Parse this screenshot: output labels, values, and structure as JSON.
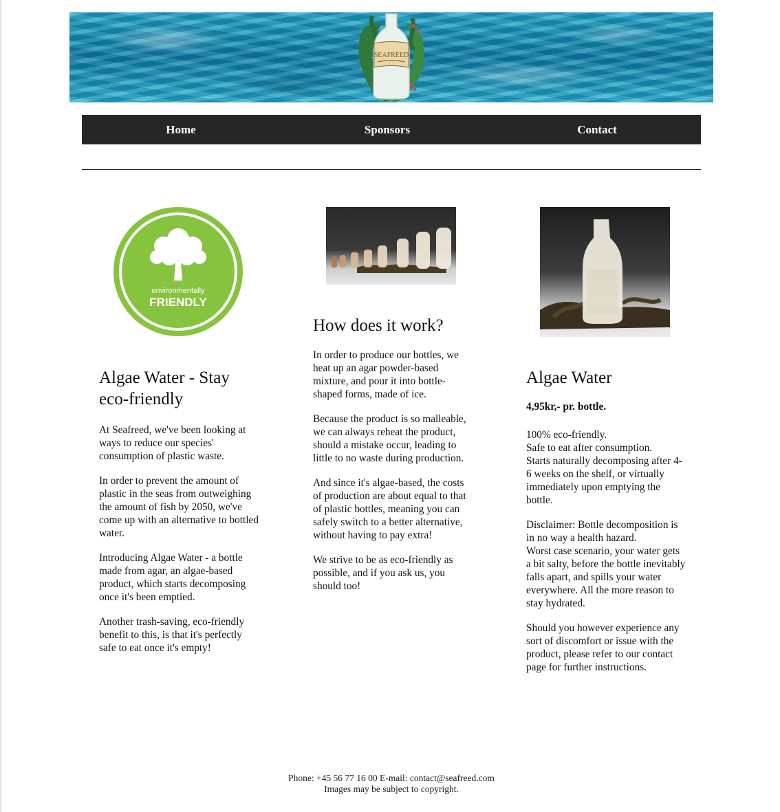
{
  "brand": {
    "logo_text": "SEAFREED"
  },
  "nav": {
    "items": [
      "Home",
      "Sponsors",
      "Contact"
    ]
  },
  "badge": {
    "line1": "environmentally",
    "line2": "FRIENDLY"
  },
  "col1": {
    "title": "Algae Water - Stay eco-friendly",
    "paragraphs": [
      "At Seafreed, we've been looking at ways to reduce our species' consumption of plastic waste.",
      "In order to prevent the amount of plastic in the seas from outweighing the amount of fish by 2050, we've come up with an alternative to bottled water.",
      "Introducing Algae Water - a bottle made from agar, an algae-based product, which starts decomposing once it's been emptied.",
      "Another trash-saving, eco-friendly benefit to this, is that it's perfectly safe to eat once it's empty!"
    ]
  },
  "col2": {
    "title": "How does it work?",
    "paragraphs": [
      "In order to produce our bottles, we heat up an agar powder-based mixture, and pour it into bottle-shaped forms, made of ice.",
      "Because the product is so malleable, we can always reheat the product, should a mistake occur, leading to little to no waste during production.",
      "And since it's algae-based, the costs of production are about equal to that of plastic bottles, meaning you can safely switch to a better alternative, without having to pay extra!",
      "We strive to be as eco-friendly as possible, and if you ask us, you should too!"
    ]
  },
  "col3": {
    "title": "Algae Water",
    "price": "4,95kr,- pr. bottle.",
    "features": [
      "100% eco-friendly.",
      "Safe to eat after consumption.",
      "Starts naturally decomposing after 4-6 weeks on the shelf, or virtually immediately upon emptying the bottle."
    ],
    "disclaimer": [
      "Disclaimer: Bottle decomposition is in no way a health hazard.",
      "Worst case scenario, your water gets a bit salty, before the bottle inevitably falls apart, and spills your water everywhere. All the more reason to stay hydrated."
    ],
    "support": "Should you however experience any sort of discomfort or issue with the product, please refer to our contact page for further instructions."
  },
  "footer": {
    "contact": "Phone: +45 56 77 16 00 E-mail: contact@seafreed.com",
    "copyright": "Images may be subject to copyright."
  },
  "colors": {
    "navbar": "#262626",
    "badge_green": "#86c440",
    "water": "#1a9fc4"
  }
}
